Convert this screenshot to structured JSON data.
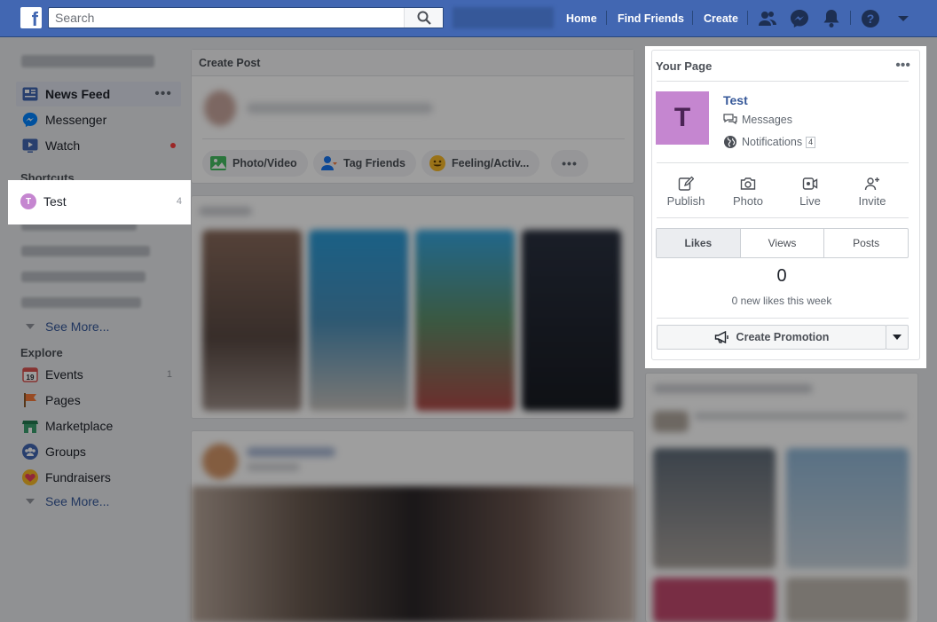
{
  "topbar": {
    "search_placeholder": "Search",
    "nav": [
      "Home",
      "Find Friends",
      "Create"
    ]
  },
  "left_nav": {
    "items": [
      {
        "label": "News Feed",
        "icon": "news-feed-icon"
      },
      {
        "label": "Messenger",
        "icon": "messenger-icon"
      },
      {
        "label": "Watch",
        "icon": "watch-icon"
      }
    ],
    "shortcuts_heading": "Shortcuts",
    "shortcut": {
      "label": "Test",
      "avatar": "T",
      "count": "4"
    },
    "see_more": "See More...",
    "explore_heading": "Explore",
    "explore_items": [
      {
        "label": "Events",
        "icon": "calendar-icon",
        "count": "1"
      },
      {
        "label": "Pages",
        "icon": "flag-icon"
      },
      {
        "label": "Marketplace",
        "icon": "shop-icon"
      },
      {
        "label": "Groups",
        "icon": "groups-icon"
      },
      {
        "label": "Fundraisers",
        "icon": "heart-icon"
      }
    ],
    "see_more_2": "See More..."
  },
  "create_post": {
    "title": "Create Post",
    "actions": [
      "Photo/Video",
      "Tag Friends",
      "Feeling/Activ..."
    ]
  },
  "your_page": {
    "title": "Your Page",
    "page_name": "Test",
    "page_initial": "T",
    "messages": "Messages",
    "notifications": "Notifications",
    "notifications_count": "4",
    "actions": [
      "Publish",
      "Photo",
      "Live",
      "Invite"
    ],
    "tabs": [
      "Likes",
      "Views",
      "Posts"
    ],
    "active_tab": "Likes",
    "likes_count": "0",
    "likes_sub": "0 new likes this week",
    "promotion": "Create Promotion"
  },
  "colors": {
    "brand": "#4267b2",
    "page_avatar": "#c586d0",
    "link": "#365899"
  }
}
